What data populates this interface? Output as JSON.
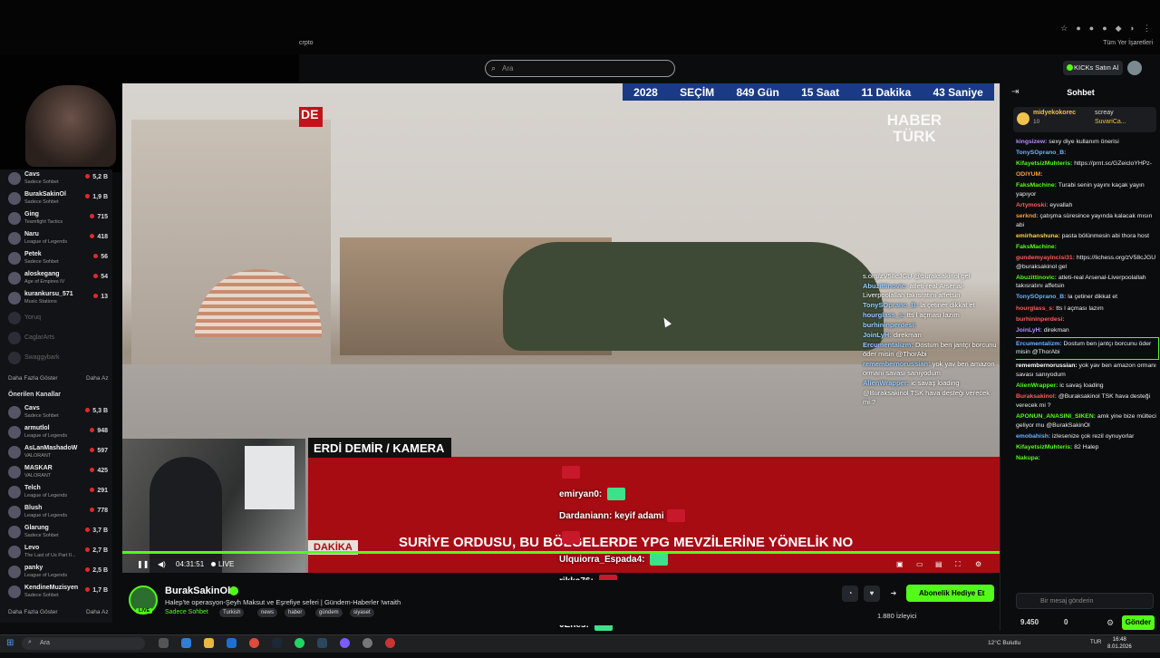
{
  "browser": {
    "bookmark": "crpto",
    "all_bookmarks": "Tüm Yer İşaretleri"
  },
  "topnav": {
    "search_placeholder": "Ara",
    "kicks_button": "KICKs Satın Al"
  },
  "sidebar": {
    "channels": [
      {
        "name": "Cavs",
        "category": "Sadece Sohbet",
        "viewers": "5,2 B"
      },
      {
        "name": "BurakSakinOl",
        "category": "Sadece Sohbet",
        "viewers": "1,9 B"
      },
      {
        "name": "Ging",
        "category": "Teamfight Tactics",
        "viewers": "715"
      },
      {
        "name": "Naru",
        "category": "League of Legends",
        "viewers": "418"
      },
      {
        "name": "Petek",
        "category": "Sadece Sohbet",
        "viewers": "56"
      },
      {
        "name": "aloskegang",
        "category": "Age of Empires IV",
        "viewers": "54"
      },
      {
        "name": "kurankursu_571",
        "category": "Music Stations",
        "viewers": "13"
      }
    ],
    "offline": [
      "Yoruq",
      "CaglarArts",
      "Swaggybark"
    ],
    "show_more": "Daha Fazla Göster",
    "show_less": "Daha Az",
    "recommended_title": "Önerilen Kanallar",
    "recommended": [
      {
        "name": "Cavs",
        "category": "Sadece Sohbet",
        "viewers": "5,3 B"
      },
      {
        "name": "armutlol",
        "category": "League of Legends",
        "viewers": "948"
      },
      {
        "name": "AsLanMashadoW",
        "category": "VALORANT",
        "viewers": "597"
      },
      {
        "name": "MASKAR",
        "category": "VALORANT",
        "viewers": "425"
      },
      {
        "name": "Telch",
        "category": "League of Legends",
        "viewers": "291"
      },
      {
        "name": "Blush",
        "category": "League of Legends",
        "viewers": "778"
      },
      {
        "name": "Glarung",
        "category": "Sadece Sohbet",
        "viewers": "3,7 B"
      },
      {
        "name": "Levo",
        "category": "The Last of Us Part II...",
        "viewers": "2,7 B"
      },
      {
        "name": "panky",
        "category": "League of Legends",
        "viewers": "2,5 B"
      },
      {
        "name": "KendineMuzisyen",
        "category": "Sadece Sohbet",
        "viewers": "1,7 B"
      }
    ]
  },
  "video": {
    "countdown": [
      "2028",
      "SEÇİM",
      "849 Gün",
      "15 Saat",
      "11 Dakika",
      "43 Saniye"
    ],
    "logo_line1": "HABER",
    "logo_line2": "TÜRK",
    "red_tag": "DE",
    "credit": "ERDİ DEMİR / KAMERA",
    "breaking": "DAKİKA",
    "ticker": "SURİYE ORDUSU, BU BÖLGELERDE YPG MEVZİLERİNE YÖNELİK NO",
    "time": "04:31:51",
    "live": "LIVE"
  },
  "overlay_chat": [
    {
      "user": "",
      "text": "s.org/zV58cJGU @buraksakinol gel"
    },
    {
      "user": "Abuzittinovic:",
      "text": "atleti-real Arsenal-Liverpoolallah takısratını affetsin"
    },
    {
      "user": "TonySOprano_B:",
      "text": "la çetiner dikkat et"
    },
    {
      "user": "hourglass_s:",
      "text": "tts l açması lazım"
    },
    {
      "user": "burhininperdesi:",
      "text": ""
    },
    {
      "user": "JoinLyH:",
      "text": "direkman"
    },
    {
      "user": "Ercumentalizm:",
      "text": "Dostum ben jantçı borcunu öder misin @ThorAbi"
    },
    {
      "user": "remembernorussian:",
      "text": "yok yav ben amazon ormanı savası sanıyodum"
    },
    {
      "user": "AlienWrapper:",
      "text": "ic savaş loading"
    },
    {
      "user": "",
      "text": "@Buraksakinol TSK hava desteği verecek mi ?"
    }
  ],
  "alert_chat": [
    {
      "user": "",
      "text": ""
    },
    {
      "user": "emiryan0:",
      "text": ""
    },
    {
      "user": "Dardaniann:",
      "text": "keyif adami"
    },
    {
      "user": "",
      "text": ""
    },
    {
      "user": "Ulquiorra_Espada4:",
      "text": ""
    },
    {
      "user": "rikka76:",
      "text": ""
    },
    {
      "user": "emiryan0:",
      "text": ""
    },
    {
      "user": "0Enes:",
      "text": ""
    },
    {
      "user": "",
      "text": ""
    }
  ],
  "stream": {
    "name": "BurakSakinOl",
    "live": "LIVE",
    "title": "Halep'te operasyon-Şeyh Maksut ve Eşrefiye seferi | Gündem-Haberler !wraith",
    "category": "Sadece Sohbet",
    "tags": [
      "Turkish",
      "news",
      "haber",
      "gündem",
      "siyaset"
    ],
    "gift_button": "Abonelik Hediye Et",
    "viewers": "1.880 İzleyici"
  },
  "chat": {
    "title": "Sohbet",
    "pinned_user": "midyekokorec",
    "pinned_count": "10",
    "pinned_user2": "screay",
    "pinned_user3": "SuvariCa...",
    "messages": [
      {
        "user": "kingsizew:",
        "color": "#b58cff",
        "text": "sexy diye kullanım önerisi"
      },
      {
        "user": "TonySOprano_B:",
        "color": "#6db3ff",
        "text": ""
      },
      {
        "user": "KifayetsizMuhteris:",
        "color": "#53fc18",
        "text": "https://prnt.sc/GZeicloYHPz-"
      },
      {
        "user": "ODIYUM:",
        "color": "#ff9d3b",
        "text": ""
      },
      {
        "user": "FaksMachine:",
        "color": "#53fc18",
        "text": "Turabi senin yayını kaçak yayın yapıyor"
      },
      {
        "user": "Artymoski:",
        "color": "#ff5b5b",
        "text": "eyvallah"
      },
      {
        "user": "serknd:",
        "color": "#ff9d3b",
        "text": "çatışma süresince yayında kalacak mısın abi"
      },
      {
        "user": "emirhanshuna:",
        "color": "#ffd24c",
        "text": "pasta bölünmesin abi thora host"
      },
      {
        "user": "FaksMachine:",
        "color": "#53fc18",
        "text": ""
      },
      {
        "user": "gundemyayincisi31:",
        "color": "#ff5b5b",
        "text": "https://lichess.org/zV58cJGU @buraksakinol gel"
      },
      {
        "user": "Abuzittinovic:",
        "color": "#53fc18",
        "text": "atleti-real Arsenal-Liverpoolallah takısratını affetsin"
      },
      {
        "user": "TonySOprano_B:",
        "color": "#6db3ff",
        "text": "la çetiner dikkat et"
      },
      {
        "user": "hourglass_s:",
        "color": "#ff5b5b",
        "text": "tts l açması lazım"
      },
      {
        "user": "burhininperdesi:",
        "color": "#ff5b5b",
        "text": ""
      },
      {
        "user": "JoinLyH:",
        "color": "#b58cff",
        "text": "direkman"
      },
      {
        "user": "Ercumentalizm:",
        "color": "#6db3ff",
        "text": "Dostum ben jantçı borcunu öder misin @ThorAbi",
        "hl": true
      },
      {
        "user": "remembernorussian:",
        "color": "#ffffff",
        "text": "yok yav ben amazon ormanı savası sanıyodum"
      },
      {
        "user": "AlienWrapper:",
        "color": "#53fc18",
        "text": "ic savaş loading"
      },
      {
        "user": "Buraksakinol:",
        "color": "#ff5b5b",
        "text": "@Buraksakinol TSK hava desteği verecek mi ?"
      },
      {
        "user": "APONUN_ANASINI_SIKEN:",
        "color": "#53fc18",
        "text": "amk yine bize mülteci geliyor mu @BurakSakinOl"
      },
      {
        "user": "emobahish:",
        "color": "#6db3ff",
        "text": "izlesenize çok rezil oynuyorlar"
      },
      {
        "user": "KifayetsizMuhteris:",
        "color": "#53fc18",
        "text": "82 Halep"
      },
      {
        "user": "Nakupa:",
        "color": "#53fc18",
        "text": ""
      }
    ],
    "input_placeholder": "Bir mesaj gönderin",
    "points": "9.450",
    "points2": "0",
    "send": "Gönder"
  },
  "taskbar": {
    "search": "Ara",
    "weather": "12°C Bulutlu",
    "lang": "TUR",
    "time": "16:48",
    "date": "8.01.2026"
  }
}
